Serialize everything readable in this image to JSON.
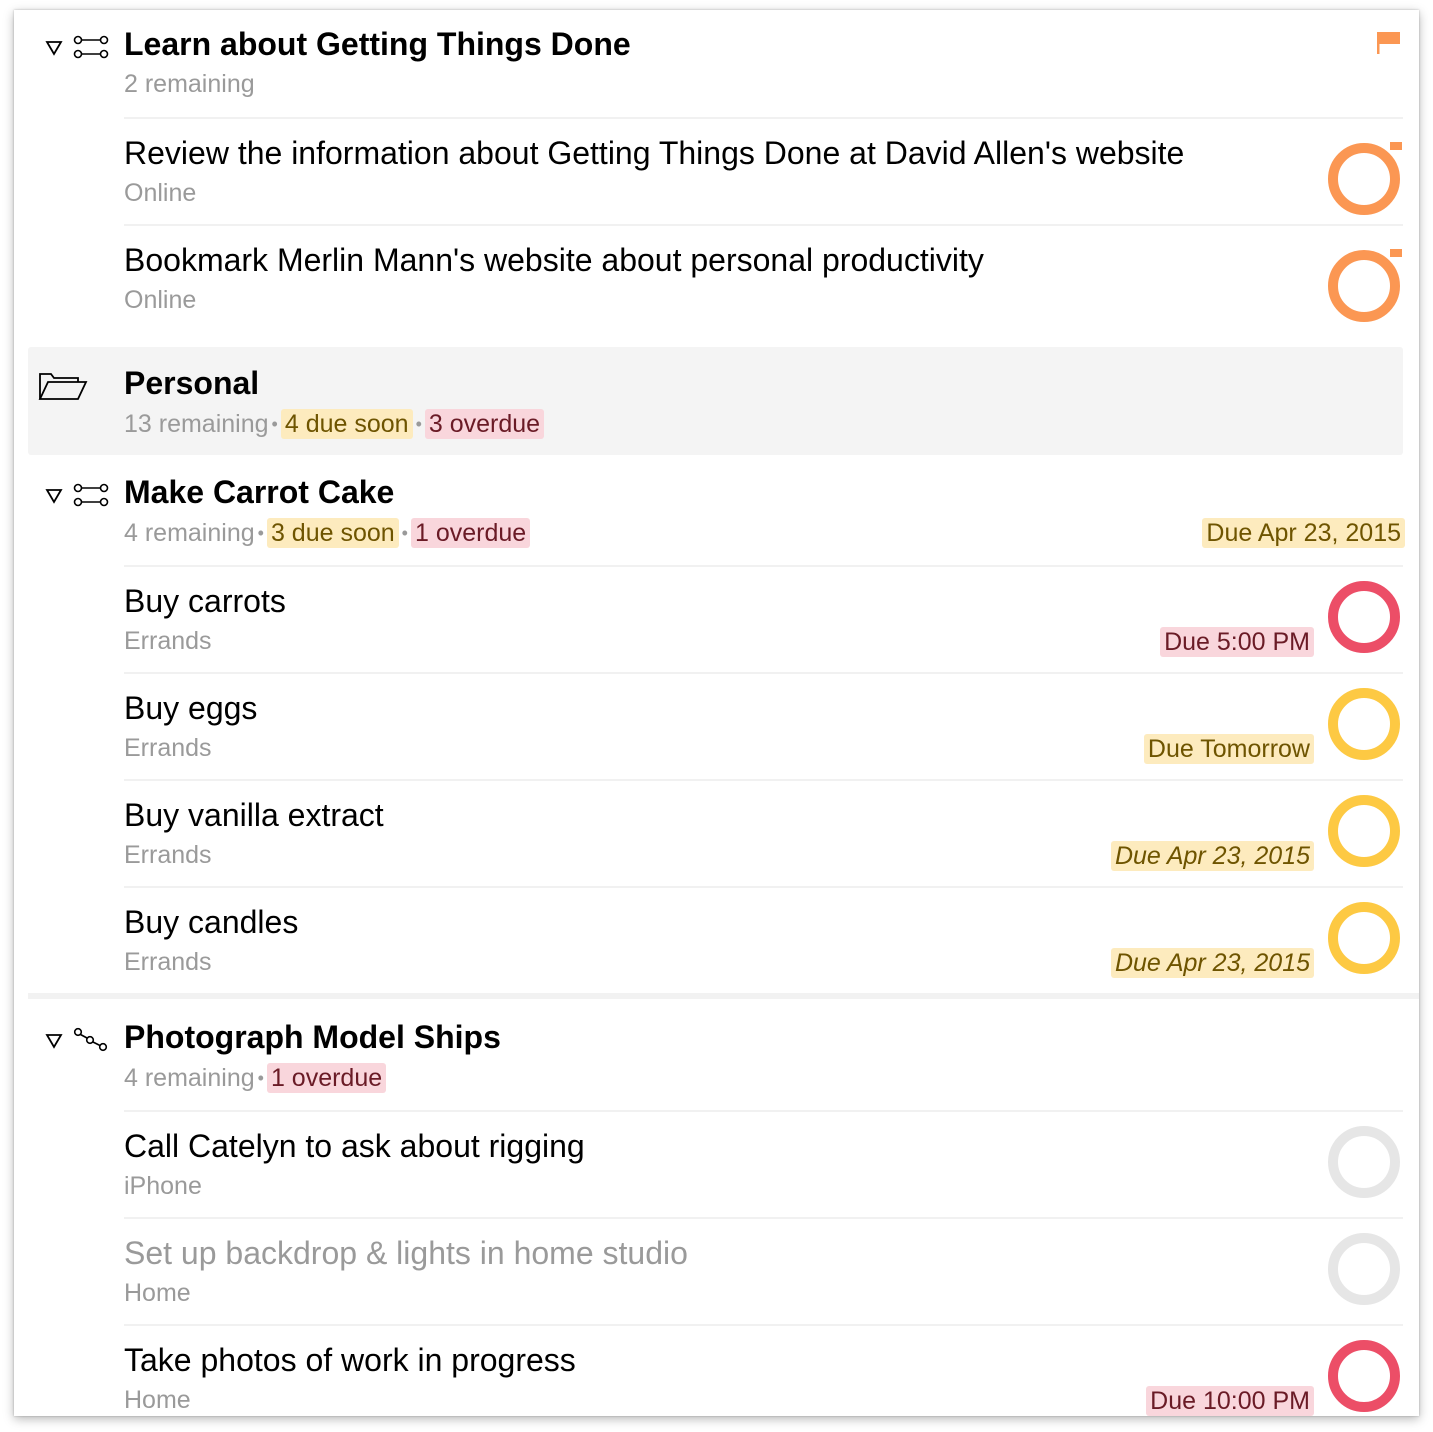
{
  "projects": [
    {
      "title": "Learn about Getting Things Done",
      "remaining": "2 remaining",
      "flagged": true,
      "tasks": [
        {
          "title": "Review the information about Getting Things Done at David Allen's website",
          "context": "Online",
          "status_color": "#fb9753",
          "flagged": true
        },
        {
          "title": "Bookmark Merlin Mann's website about personal productivity",
          "context": "Online",
          "status_color": "#fb9753",
          "flagged": true
        }
      ]
    },
    {
      "folder": "Personal",
      "remaining": "13 remaining",
      "due_soon": "4 due soon",
      "overdue": "3 overdue"
    },
    {
      "title": "Make Carrot Cake",
      "remaining": "4 remaining",
      "due_soon": "3 due soon",
      "overdue": "1 overdue",
      "due": "Due Apr 23, 2015",
      "tasks": [
        {
          "title": "Buy carrots",
          "context": "Errands",
          "due": "Due 5:00 PM",
          "due_type": "overdue",
          "status_color": "#ec4e67"
        },
        {
          "title": "Buy eggs",
          "context": "Errands",
          "due": "Due Tomorrow",
          "due_type": "soon",
          "status_color": "#fdc943"
        },
        {
          "title": "Buy vanilla extract",
          "context": "Errands",
          "due": "Due Apr 23, 2015",
          "due_type": "soon-inherited",
          "status_color": "#fdc943"
        },
        {
          "title": "Buy candles",
          "context": "Errands",
          "due": "Due Apr 23, 2015",
          "due_type": "soon-inherited",
          "status_color": "#fdc943"
        }
      ]
    },
    {
      "title": "Photograph Model Ships",
      "remaining": "4 remaining",
      "overdue": "1 overdue",
      "tasks": [
        {
          "title": "Call Catelyn to ask about rigging",
          "context": "iPhone",
          "status_color": "#e6e6e6"
        },
        {
          "title": "Set up backdrop & lights in home studio",
          "context": "Home",
          "status_color": "#e6e6e6",
          "blocked": true
        },
        {
          "title": "Take photos of work in progress",
          "context": "Home",
          "due": "Due 10:00 PM",
          "due_type": "overdue",
          "status_color": "#ec4e67"
        }
      ]
    }
  ],
  "separator": "•",
  "colors": {
    "flag": "#fb9753",
    "due_soon_bg": "#fdebbe",
    "overdue_bg": "#f9d6dc",
    "overdue_ring": "#ec4e67",
    "due_soon_ring": "#fdc943",
    "available_ring": "#e6e6e6"
  }
}
